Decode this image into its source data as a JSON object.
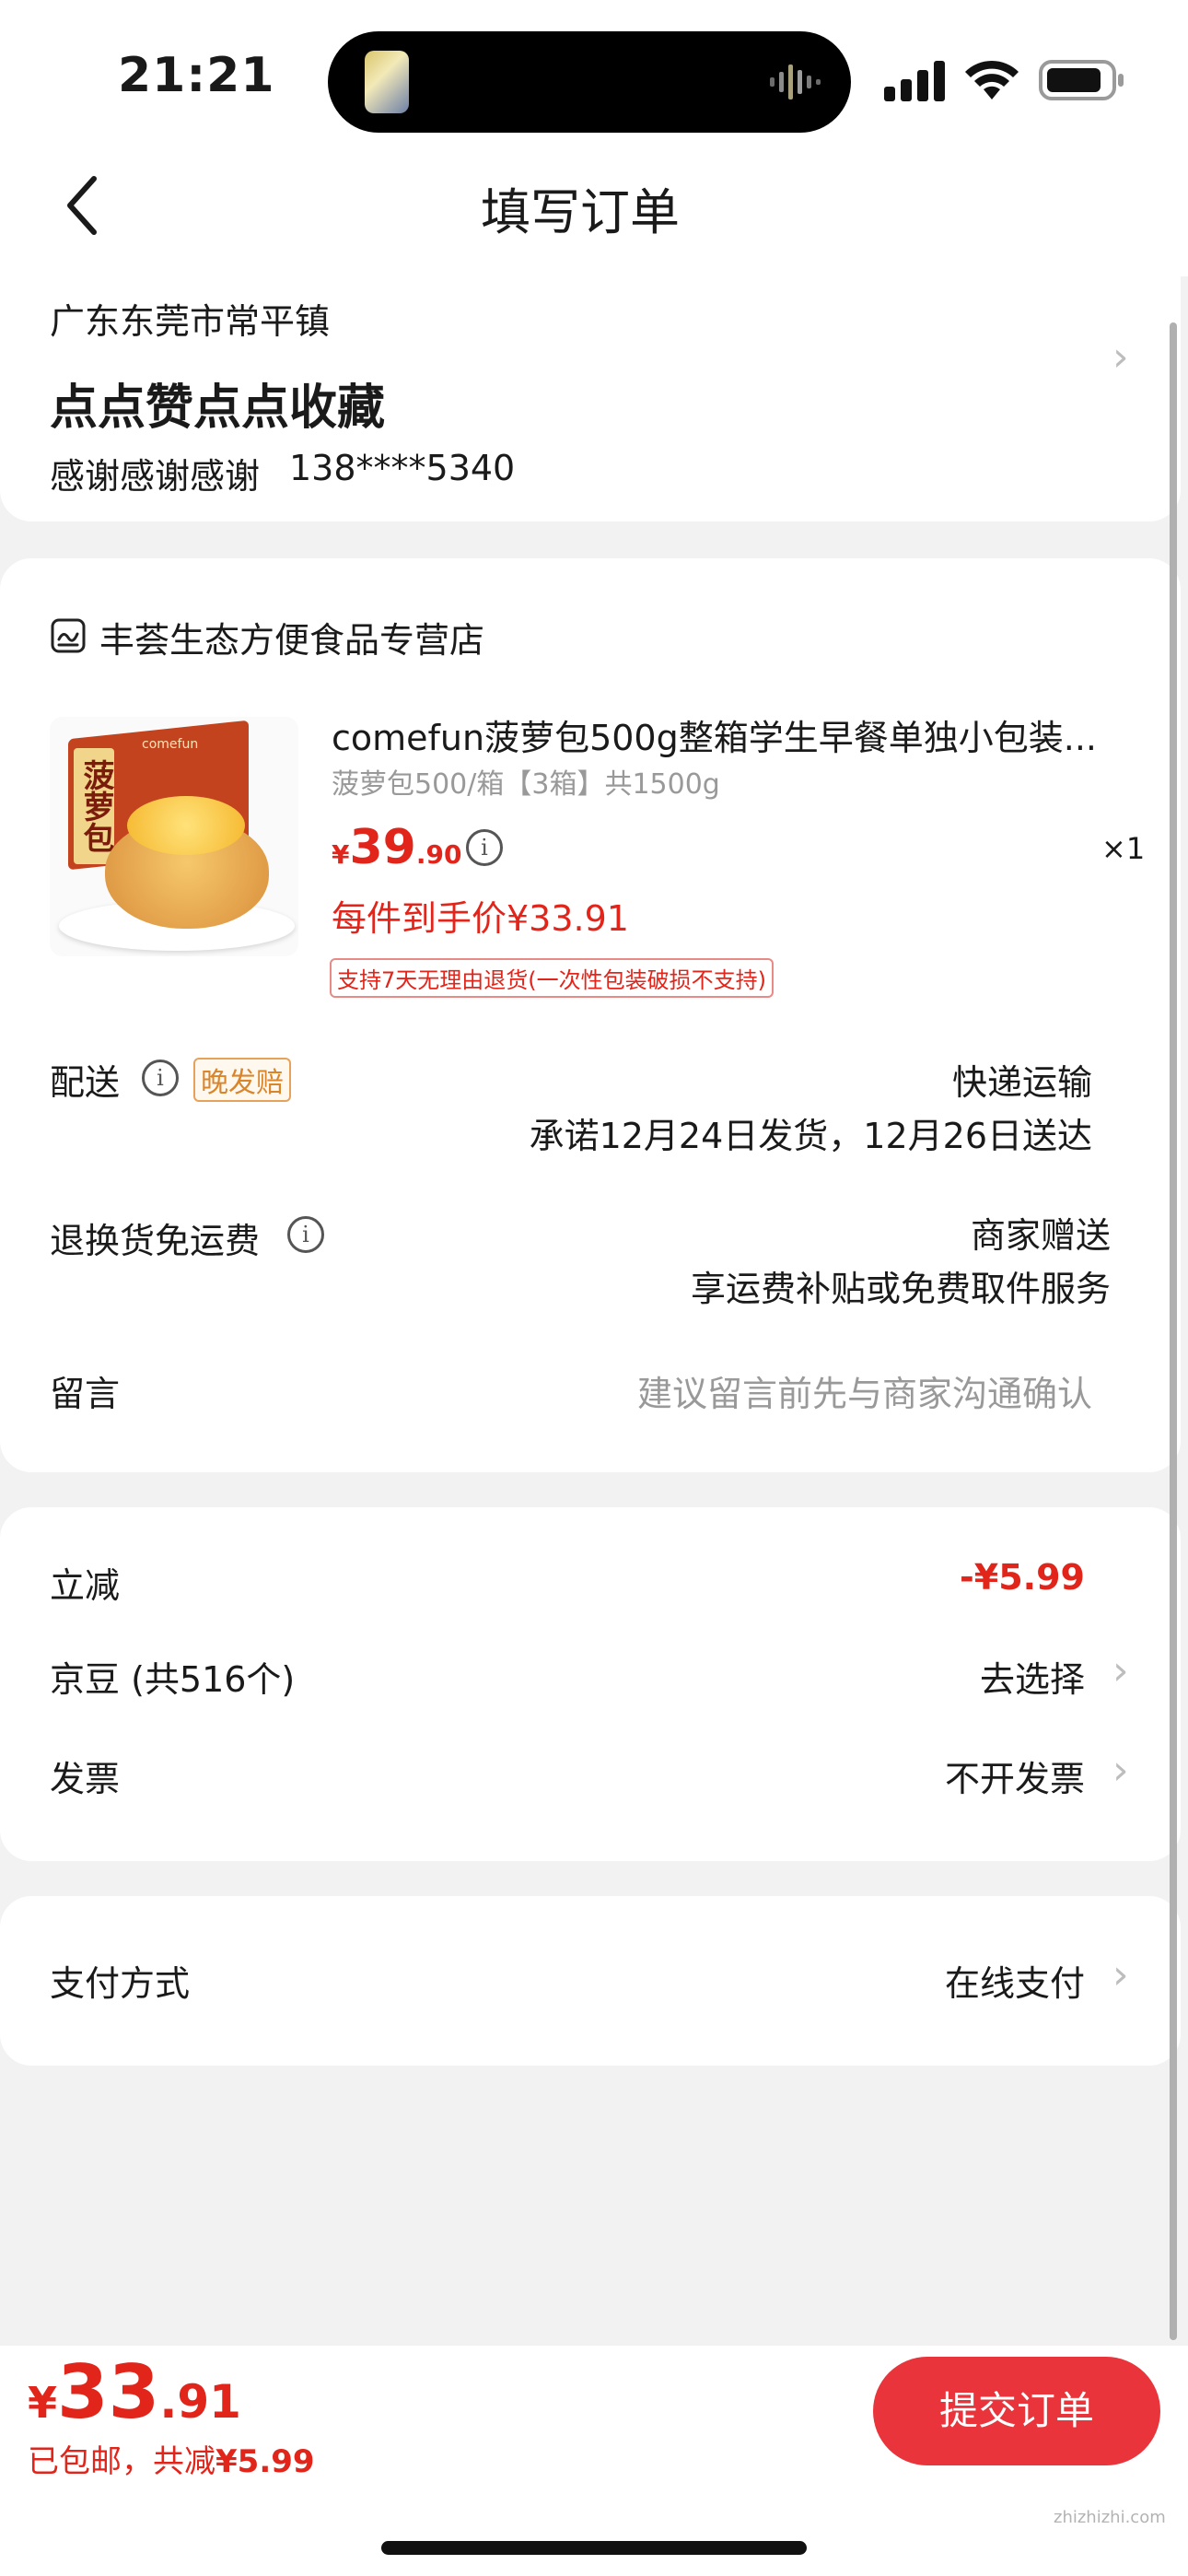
{
  "status_bar": {
    "time": "21:21"
  },
  "header": {
    "title": "填写订单"
  },
  "address": {
    "region": "广东东莞市常平镇",
    "detail": "点点赞点点收藏",
    "contact_name": "感谢感谢感谢",
    "phone": "138****5340"
  },
  "store": {
    "name": "丰荟生态方便食品专营店",
    "product": {
      "title": "comefun菠萝包500g整箱学生早餐单独小包装...",
      "spec": "菠萝包500/箱【3箱】共1500g",
      "currency": "¥",
      "price_int": "39",
      "price_dec": ".90",
      "quantity": "×1",
      "final_price_label": "每件到手价¥33.91",
      "return_policy": "支持7天无理由退货(一次性包装破损不支持)",
      "image_text": "菠萝包",
      "image_brand": "comefun"
    },
    "delivery": {
      "label": "配送",
      "tag": "晚发赔",
      "method": "快递运输",
      "promise": "承诺12月24日发货，12月26日送达"
    },
    "return_shipping": {
      "label": "退换货免运费",
      "value_line1": "商家赠送",
      "value_line2": "享运费补贴或免费取件服务"
    },
    "message": {
      "label": "留言",
      "placeholder": "建议留言前先与商家沟通确认"
    }
  },
  "discounts": {
    "instant_label": "立减",
    "instant_value": "-¥5.99",
    "jingdou_label": "京豆 (共516个)",
    "jingdou_value": "去选择",
    "invoice_label": "发票",
    "invoice_value": "不开发票"
  },
  "payment": {
    "label": "支付方式",
    "value": "在线支付"
  },
  "footer": {
    "currency": "¥",
    "total_int": "33",
    "total_dec": ".91",
    "summary_prefix": "已包邮，共减",
    "summary_amount": "¥5.99",
    "submit_label": "提交订单"
  },
  "watermark": {
    "text": "zhizhizhi.com"
  },
  "colors": {
    "accent": "#e1251b",
    "submit_bg": "#e8343a",
    "tag_border": "#e6a15a"
  }
}
